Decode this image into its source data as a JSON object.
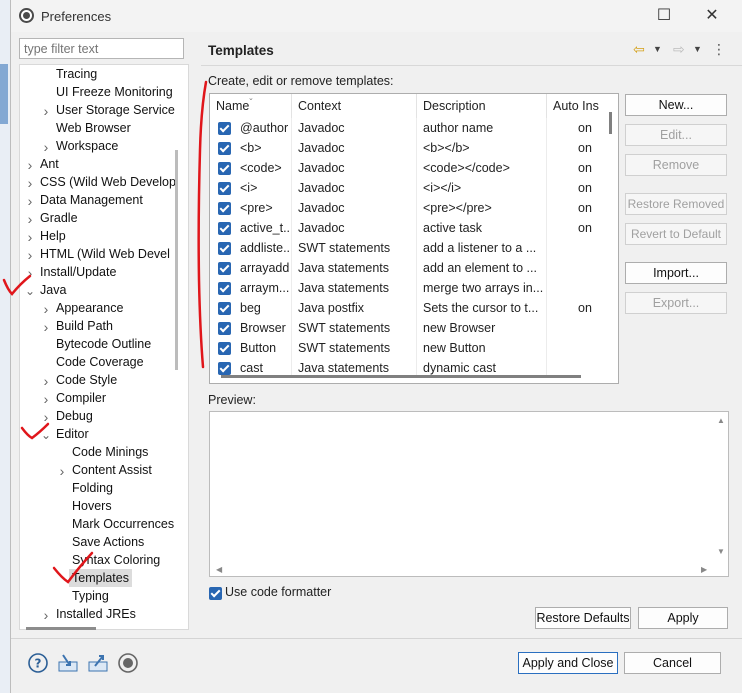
{
  "window": {
    "title": "Preferences"
  },
  "filter": {
    "placeholder": "type filter text"
  },
  "tree": [
    {
      "label": "Tracing",
      "level": 2,
      "twisty": ""
    },
    {
      "label": "UI Freeze Monitoring",
      "level": 2,
      "twisty": ""
    },
    {
      "label": "User Storage Service",
      "level": 2,
      "twisty": ">"
    },
    {
      "label": "Web Browser",
      "level": 2,
      "twisty": ""
    },
    {
      "label": "Workspace",
      "level": 2,
      "twisty": ">"
    },
    {
      "label": "Ant",
      "level": 1,
      "twisty": ">"
    },
    {
      "label": "CSS (Wild Web Develop",
      "level": 1,
      "twisty": ">"
    },
    {
      "label": "Data Management",
      "level": 1,
      "twisty": ">"
    },
    {
      "label": "Gradle",
      "level": 1,
      "twisty": ">"
    },
    {
      "label": "Help",
      "level": 1,
      "twisty": ">"
    },
    {
      "label": "HTML (Wild Web Devel",
      "level": 1,
      "twisty": ">"
    },
    {
      "label": "Install/Update",
      "level": 1,
      "twisty": ">"
    },
    {
      "label": "Java",
      "level": 1,
      "twisty": "v"
    },
    {
      "label": "Appearance",
      "level": 2,
      "twisty": ">"
    },
    {
      "label": "Build Path",
      "level": 2,
      "twisty": ">"
    },
    {
      "label": "Bytecode Outline",
      "level": 2,
      "twisty": ""
    },
    {
      "label": "Code Coverage",
      "level": 2,
      "twisty": ""
    },
    {
      "label": "Code Style",
      "level": 2,
      "twisty": ">"
    },
    {
      "label": "Compiler",
      "level": 2,
      "twisty": ">"
    },
    {
      "label": "Debug",
      "level": 2,
      "twisty": ">"
    },
    {
      "label": "Editor",
      "level": 2,
      "twisty": "v"
    },
    {
      "label": "Code Minings",
      "level": 3,
      "twisty": ""
    },
    {
      "label": "Content Assist",
      "level": 3,
      "twisty": ">"
    },
    {
      "label": "Folding",
      "level": 3,
      "twisty": ""
    },
    {
      "label": "Hovers",
      "level": 3,
      "twisty": ""
    },
    {
      "label": "Mark Occurrences",
      "level": 3,
      "twisty": ""
    },
    {
      "label": "Save Actions",
      "level": 3,
      "twisty": ""
    },
    {
      "label": "Syntax Coloring",
      "level": 3,
      "twisty": ""
    },
    {
      "label": "Templates",
      "level": 3,
      "twisty": "",
      "selected": true
    },
    {
      "label": "Typing",
      "level": 3,
      "twisty": ""
    },
    {
      "label": "Installed JREs",
      "level": 2,
      "twisty": ">"
    }
  ],
  "page": {
    "title": "Templates",
    "instruction": "Create, edit or remove templates:",
    "back_icon": "arrow-left-icon",
    "forward_icon": "arrow-right-icon"
  },
  "table": {
    "columns": [
      "Name",
      "Context",
      "Description",
      "Auto Ins"
    ],
    "rows": [
      {
        "name": "@author",
        "context": "Javadoc",
        "description": "author name",
        "auto": "on"
      },
      {
        "name": "<b>",
        "context": "Javadoc",
        "description": "<b></b>",
        "auto": "on"
      },
      {
        "name": "<code>",
        "context": "Javadoc",
        "description": "<code></code>",
        "auto": "on"
      },
      {
        "name": "<i>",
        "context": "Javadoc",
        "description": "<i></i>",
        "auto": "on"
      },
      {
        "name": "<pre>",
        "context": "Javadoc",
        "description": "<pre></pre>",
        "auto": "on"
      },
      {
        "name": "active_t...",
        "context": "Javadoc",
        "description": "active task",
        "auto": "on"
      },
      {
        "name": "addliste...",
        "context": "SWT statements",
        "description": "add a listener to a ...",
        "auto": ""
      },
      {
        "name": "arrayadd",
        "context": "Java statements",
        "description": "add an element to ...",
        "auto": ""
      },
      {
        "name": "arraym...",
        "context": "Java statements",
        "description": "merge two arrays in...",
        "auto": ""
      },
      {
        "name": "beg",
        "context": "Java postfix",
        "description": "Sets the cursor to t...",
        "auto": "on"
      },
      {
        "name": "Browser",
        "context": "SWT statements",
        "description": "new Browser",
        "auto": ""
      },
      {
        "name": "Button",
        "context": "SWT statements",
        "description": "new Button",
        "auto": ""
      },
      {
        "name": "cast",
        "context": "Java statements",
        "description": "dynamic cast",
        "auto": ""
      }
    ]
  },
  "side_buttons": {
    "new": "New...",
    "edit": "Edit...",
    "remove": "Remove",
    "restore_removed": "Restore Removed",
    "revert": "Revert to Default",
    "import": "Import...",
    "export": "Export..."
  },
  "preview": {
    "label": "Preview:"
  },
  "formatter": {
    "label": "Use code formatter",
    "checked": true
  },
  "buttons": {
    "restore_defaults": "Restore Defaults",
    "apply": "Apply",
    "apply_close": "Apply and Close",
    "cancel": "Cancel"
  },
  "colors": {
    "accent": "#2866b2",
    "annotation": "#e0161b"
  }
}
